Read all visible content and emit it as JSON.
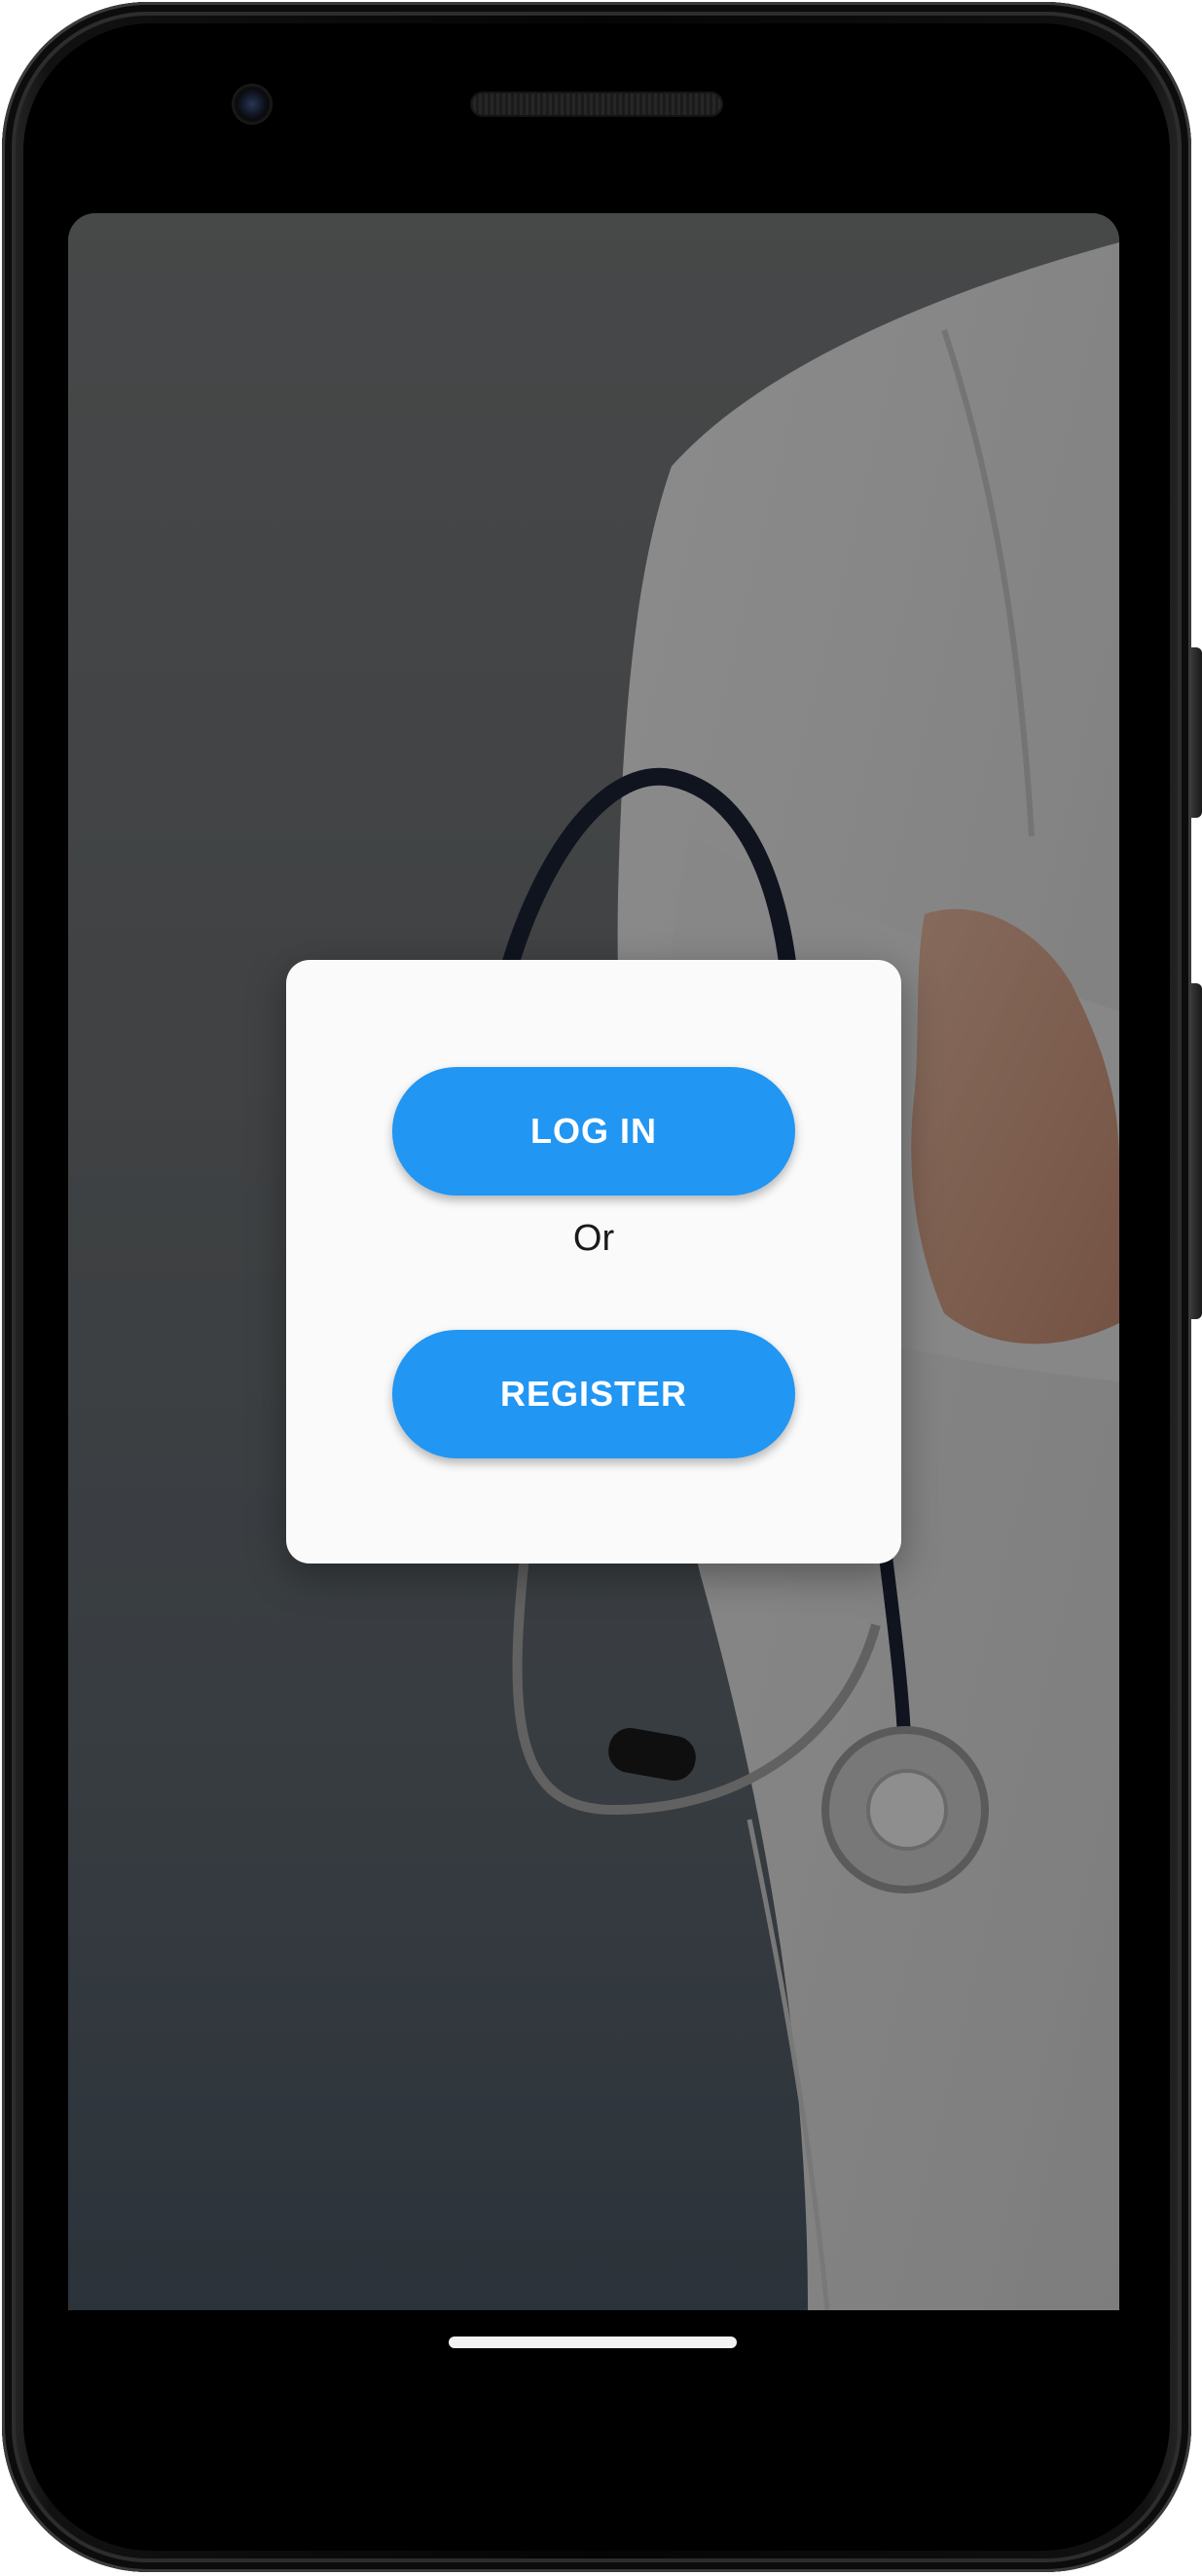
{
  "device": {
    "frame_icon": "phone-frame",
    "camera_icon": "front-camera-icon",
    "speaker_icon": "earpiece-speaker-icon"
  },
  "background": {
    "image_subject_icon": "doctor-with-stethoscope-image",
    "scrim_color": "#000000"
  },
  "dialog": {
    "login_label": "LOG IN",
    "separator_text": "Or",
    "register_label": "REGISTER",
    "button_color": "#2196f3",
    "button_text_color": "#ffffff",
    "card_color": "#fafafa"
  },
  "system": {
    "home_indicator_icon": "home-indicator"
  }
}
